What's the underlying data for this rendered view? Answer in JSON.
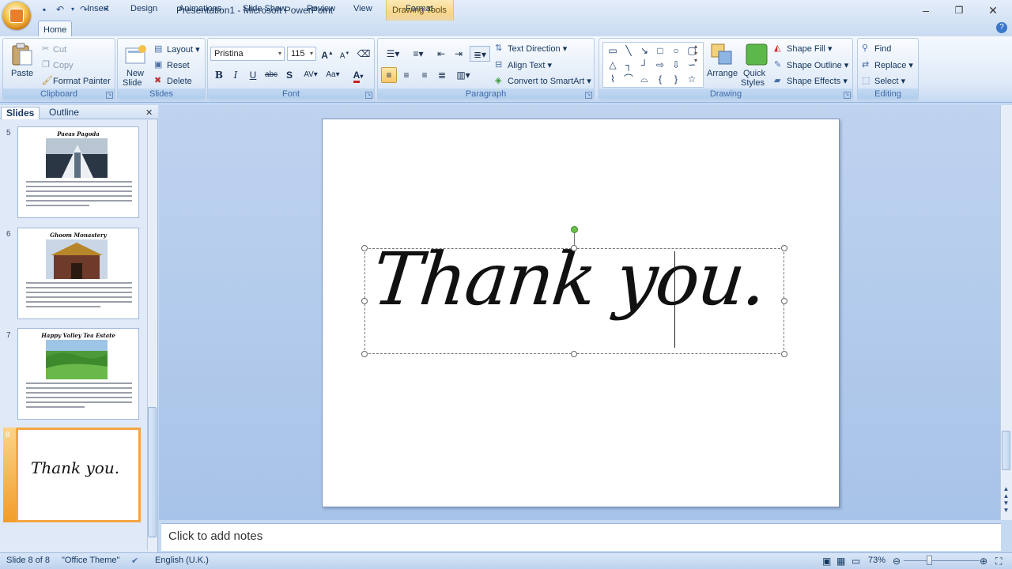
{
  "window": {
    "title": "Presentation1 - Microsoft PowerPoint",
    "contextual_tab_group": "Drawing Tools"
  },
  "tabs": [
    "Home",
    "Insert",
    "Design",
    "Animations",
    "Slide Show",
    "Review",
    "View",
    "Format"
  ],
  "active_tab": "Home",
  "ribbon": {
    "clipboard": {
      "paste": "Paste",
      "cut": "Cut",
      "copy": "Copy",
      "format_painter": "Format Painter",
      "label": "Clipboard"
    },
    "slides": {
      "new_slide_line1": "New",
      "new_slide_line2": "Slide",
      "layout": "Layout",
      "reset": "Reset",
      "delete": "Delete",
      "label": "Slides"
    },
    "font": {
      "font_name": "Pristina",
      "font_size": "115",
      "label": "Font"
    },
    "paragraph": {
      "text_direction": "Text Direction",
      "align_text": "Align Text",
      "convert_smartart": "Convert to SmartArt",
      "label": "Paragraph"
    },
    "drawing": {
      "arrange": "Arrange",
      "quick_styles_line1": "Quick",
      "quick_styles_line2": "Styles",
      "shape_fill": "Shape Fill",
      "shape_outline": "Shape Outline",
      "shape_effects": "Shape Effects",
      "label": "Drawing"
    },
    "editing": {
      "find": "Find",
      "replace": "Replace",
      "select": "Select",
      "label": "Editing"
    }
  },
  "panel_tabs": {
    "slides": "Slides",
    "outline": "Outline"
  },
  "thumbnails": [
    {
      "number": "5",
      "title": "Paeas Pagoda"
    },
    {
      "number": "6",
      "title": "Ghoom Monastery"
    },
    {
      "number": "7",
      "title": "Happy Valley Tea Estate"
    },
    {
      "number": "8",
      "text": "Thank you."
    }
  ],
  "slide": {
    "text": "Thank you."
  },
  "notes_placeholder": "Click to add notes",
  "status": {
    "slide_info": "Slide 8 of 8",
    "theme": "\"Office Theme\"",
    "language": "English (U.K.)",
    "zoom": "73%"
  },
  "colors": {
    "accent": "#f4a541",
    "ribbon": "#dfeaf8",
    "canvas": "#a7c3e8"
  }
}
